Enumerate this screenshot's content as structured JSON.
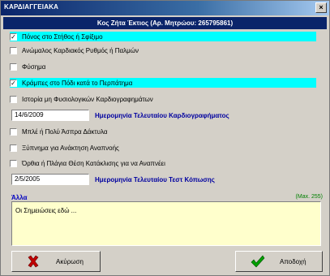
{
  "window": {
    "title": "ΚΑΡΔΙΑΓΓΕΙΑΚΑ",
    "close_glyph": "×"
  },
  "patient": {
    "header": "Κος Ζήτα Έκτιος (Αρ. Μητρώου: 265795861)"
  },
  "checkboxes": [
    {
      "label": "Πόνος στο Στήθος ή Σφίξιμο",
      "checked": true,
      "highlighted": true
    },
    {
      "label": "Ανώμαλος Καρδιακός Ρυθμός ή Παλμών",
      "checked": false,
      "highlighted": false
    },
    {
      "label": "Φύσημα",
      "checked": false,
      "highlighted": false
    },
    {
      "label": "Κράμπες στο Πόδι κατά το Περπάτημα",
      "checked": true,
      "highlighted": true
    },
    {
      "label": "Ιστορία μη Φυσιολογικών Καρδιογραφημάτων",
      "checked": false,
      "highlighted": false
    },
    {
      "label": "Μπλέ ή Πολύ Άσπρα Δάκτυλα",
      "checked": false,
      "highlighted": false
    },
    {
      "label": "Ξύπνημα για Ανάκτηση Αναπνοής",
      "checked": false,
      "highlighted": false
    },
    {
      "label": "Όρθια ή Πλάγια Θέση Κατάκλισης για να Αναπνέει",
      "checked": false,
      "highlighted": false
    }
  ],
  "ecg_date": {
    "value": "14/6/2009",
    "label": "Ημερομηνία Τελευταίου Καρδιογραφήματος"
  },
  "stress_date": {
    "value": "2/5/2005",
    "label": "Ημερομηνία Τελευταίου Τεστ Κόπωσης"
  },
  "other": {
    "label": "Άλλα",
    "max": "(Max. 255)",
    "notes": "Οι Σημειώσεις εδώ ..."
  },
  "buttons": {
    "cancel": "Ακύρωση",
    "accept": "Αποδοχή"
  },
  "colors": {
    "highlight": "#00ffff",
    "header_bg": "#0a246a",
    "date_label": "#0000a0",
    "notes_bg": "#ffffcc"
  }
}
